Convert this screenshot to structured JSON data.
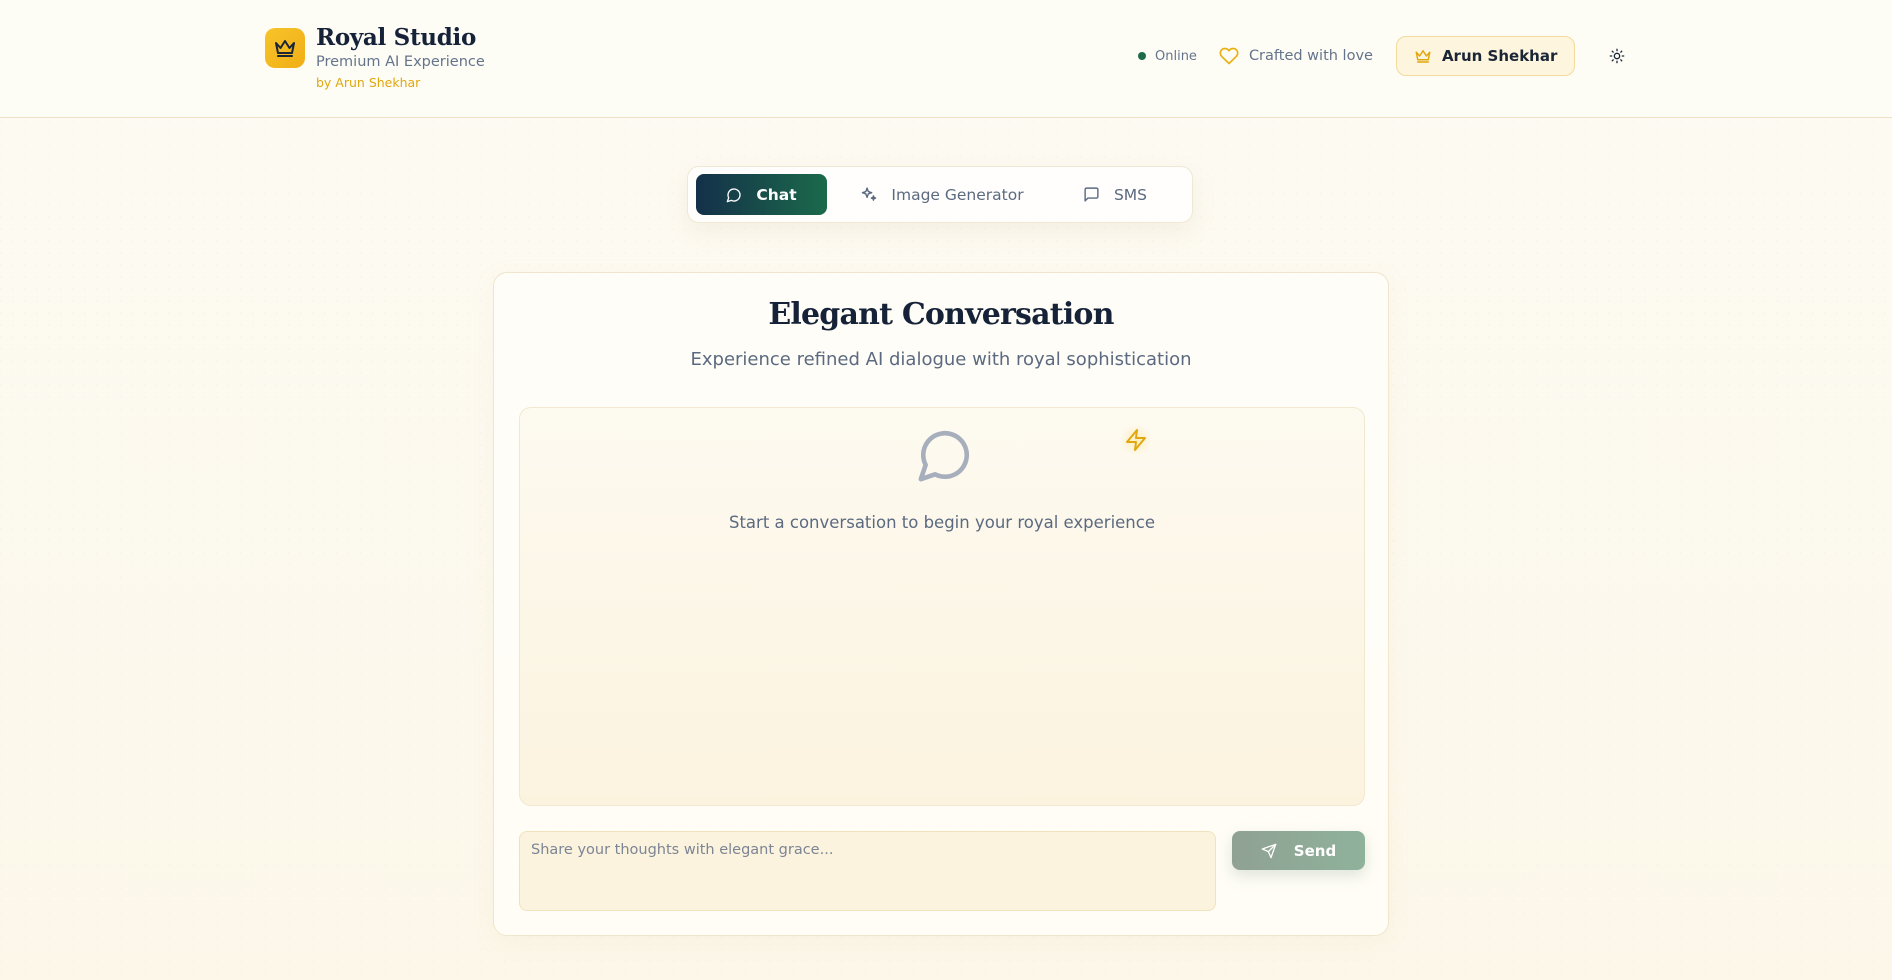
{
  "brand": {
    "title": "Royal Studio",
    "subtitle": "Premium AI Experience",
    "byline": "by Arun Shekhar",
    "logo_icon": "crown-icon"
  },
  "header": {
    "status": "Online",
    "crafted": "Crafted with love",
    "user_name": "Arun Shekhar",
    "theme_icon": "sun-icon"
  },
  "tabs": [
    {
      "label": "Chat",
      "icon": "message-circle-icon",
      "active": true
    },
    {
      "label": "Image Generator",
      "icon": "sparkles-icon",
      "active": false
    },
    {
      "label": "SMS",
      "icon": "message-square-icon",
      "active": false
    }
  ],
  "chat": {
    "title": "Elegant Conversation",
    "subtitle": "Experience refined AI dialogue with royal sophistication",
    "empty_message": "Start a conversation to begin your royal experience",
    "input_placeholder": "Share your thoughts with elegant grace...",
    "input_value": "",
    "send_label": "Send"
  },
  "colors": {
    "accent_gold": "#f5b91f",
    "tab_active_start": "#14304a",
    "tab_active_end": "#1b6a4b",
    "status_online": "#1e6b4c",
    "send_button": "#8fa99a"
  }
}
